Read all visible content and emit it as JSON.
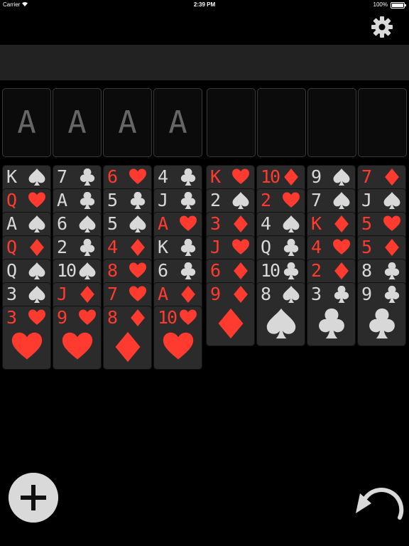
{
  "status": {
    "carrier": "Carrier",
    "time": "2:39 PM",
    "battery": "100%"
  },
  "colors": {
    "red": "#ff3b30",
    "black_suit": "#d8d8d8",
    "card": "#2b2b2b",
    "band": "#222222"
  },
  "foundations": [
    {
      "label": "A"
    },
    {
      "label": "A"
    },
    {
      "label": "A"
    },
    {
      "label": "A"
    }
  ],
  "free_cells": [
    {},
    {},
    {},
    {}
  ],
  "columns": [
    [
      {
        "rank": "K",
        "suit": "spade"
      },
      {
        "rank": "Q",
        "suit": "heart"
      },
      {
        "rank": "A",
        "suit": "spade"
      },
      {
        "rank": "Q",
        "suit": "diamond"
      },
      {
        "rank": "Q",
        "suit": "spade"
      },
      {
        "rank": "3",
        "suit": "spade"
      },
      {
        "rank": "3",
        "suit": "heart"
      }
    ],
    [
      {
        "rank": "7",
        "suit": "club"
      },
      {
        "rank": "A",
        "suit": "club"
      },
      {
        "rank": "6",
        "suit": "spade"
      },
      {
        "rank": "2",
        "suit": "club"
      },
      {
        "rank": "10",
        "suit": "spade"
      },
      {
        "rank": "J",
        "suit": "diamond"
      },
      {
        "rank": "9",
        "suit": "heart"
      }
    ],
    [
      {
        "rank": "6",
        "suit": "heart"
      },
      {
        "rank": "5",
        "suit": "club"
      },
      {
        "rank": "5",
        "suit": "spade"
      },
      {
        "rank": "4",
        "suit": "diamond"
      },
      {
        "rank": "8",
        "suit": "heart"
      },
      {
        "rank": "7",
        "suit": "heart"
      },
      {
        "rank": "8",
        "suit": "diamond"
      }
    ],
    [
      {
        "rank": "4",
        "suit": "club"
      },
      {
        "rank": "J",
        "suit": "club"
      },
      {
        "rank": "A",
        "suit": "heart"
      },
      {
        "rank": "K",
        "suit": "club"
      },
      {
        "rank": "6",
        "suit": "club"
      },
      {
        "rank": "A",
        "suit": "diamond"
      },
      {
        "rank": "10",
        "suit": "heart"
      }
    ],
    [
      {
        "rank": "K",
        "suit": "heart"
      },
      {
        "rank": "2",
        "suit": "spade"
      },
      {
        "rank": "3",
        "suit": "diamond"
      },
      {
        "rank": "J",
        "suit": "heart"
      },
      {
        "rank": "6",
        "suit": "diamond"
      },
      {
        "rank": "9",
        "suit": "diamond"
      }
    ],
    [
      {
        "rank": "10",
        "suit": "diamond"
      },
      {
        "rank": "2",
        "suit": "heart"
      },
      {
        "rank": "4",
        "suit": "spade"
      },
      {
        "rank": "Q",
        "suit": "club"
      },
      {
        "rank": "10",
        "suit": "club"
      },
      {
        "rank": "8",
        "suit": "spade"
      }
    ],
    [
      {
        "rank": "9",
        "suit": "spade"
      },
      {
        "rank": "7",
        "suit": "spade"
      },
      {
        "rank": "K",
        "suit": "diamond"
      },
      {
        "rank": "4",
        "suit": "heart"
      },
      {
        "rank": "2",
        "suit": "diamond"
      },
      {
        "rank": "3",
        "suit": "club"
      }
    ],
    [
      {
        "rank": "7",
        "suit": "diamond"
      },
      {
        "rank": "J",
        "suit": "spade"
      },
      {
        "rank": "5",
        "suit": "heart"
      },
      {
        "rank": "5",
        "suit": "diamond"
      },
      {
        "rank": "8",
        "suit": "club"
      },
      {
        "rank": "9",
        "suit": "club"
      }
    ]
  ],
  "icons": {
    "settings": "gear-icon",
    "add": "plus-icon",
    "undo": "undo-arrow-icon"
  }
}
